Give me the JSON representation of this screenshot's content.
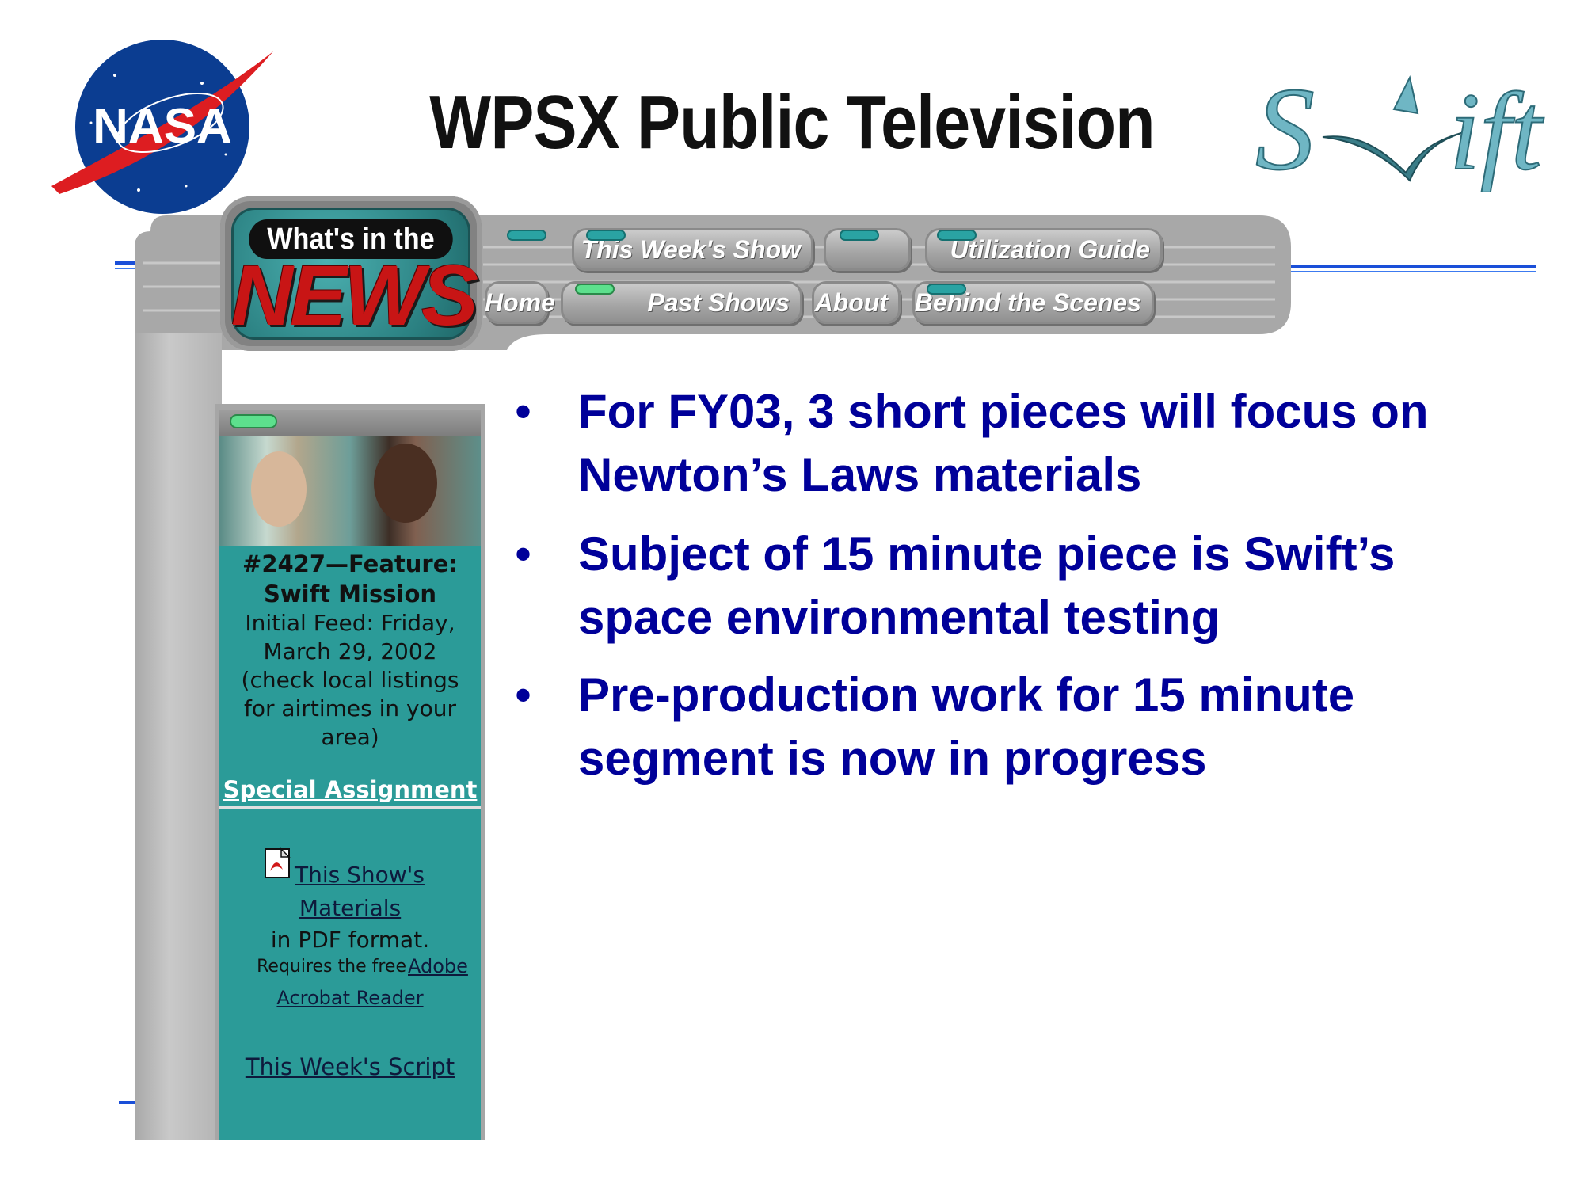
{
  "slide": {
    "title": "WPSX Public Television"
  },
  "logos": {
    "nasa_text": "NASA",
    "swift_text": "Swift"
  },
  "badge": {
    "top": "What's in the",
    "word": "NEWS"
  },
  "nav": {
    "home": "Home",
    "this_weeks_show": "This Week's Show",
    "past_shows": "Past Shows",
    "about": "About",
    "utilization_guide": "Utilization Guide",
    "behind_the_scenes": "Behind the Scenes"
  },
  "sidebar": {
    "episode": "#2427—Feature:",
    "subject": "Swift Mission",
    "feed_line1": "Initial Feed: Friday,",
    "feed_line2": "March 29, 2002",
    "feed_line3": "(check local listings",
    "feed_line4": "for airtimes in your",
    "feed_line5": "area)",
    "special_assignment": "Special Assignment",
    "materials_link1": "This Show's",
    "materials_link2": "Materials",
    "pdf_format": "in PDF format.",
    "requires": "Requires the free",
    "adobe_link1": "Adobe",
    "adobe_link2": "Acrobat Reader",
    "script_link": "This Week's Script"
  },
  "bullets": [
    {
      "dot": "•",
      "line1": "For FY03, 3 short pieces will focus on",
      "line2": "Newton’s Laws materials"
    },
    {
      "dot": "•",
      "line1": "Subject of 15 minute piece is Swift’s",
      "line2": "space environmental testing"
    },
    {
      "dot": "•",
      "line1": "Pre-production work for 15 minute",
      "line2": "segment is now in progress"
    }
  ],
  "colors": {
    "bullet_text": "#000099",
    "teal_panel": "#2b9b98",
    "news_red": "#c81515",
    "rule_blue": "#1a4fd8"
  }
}
